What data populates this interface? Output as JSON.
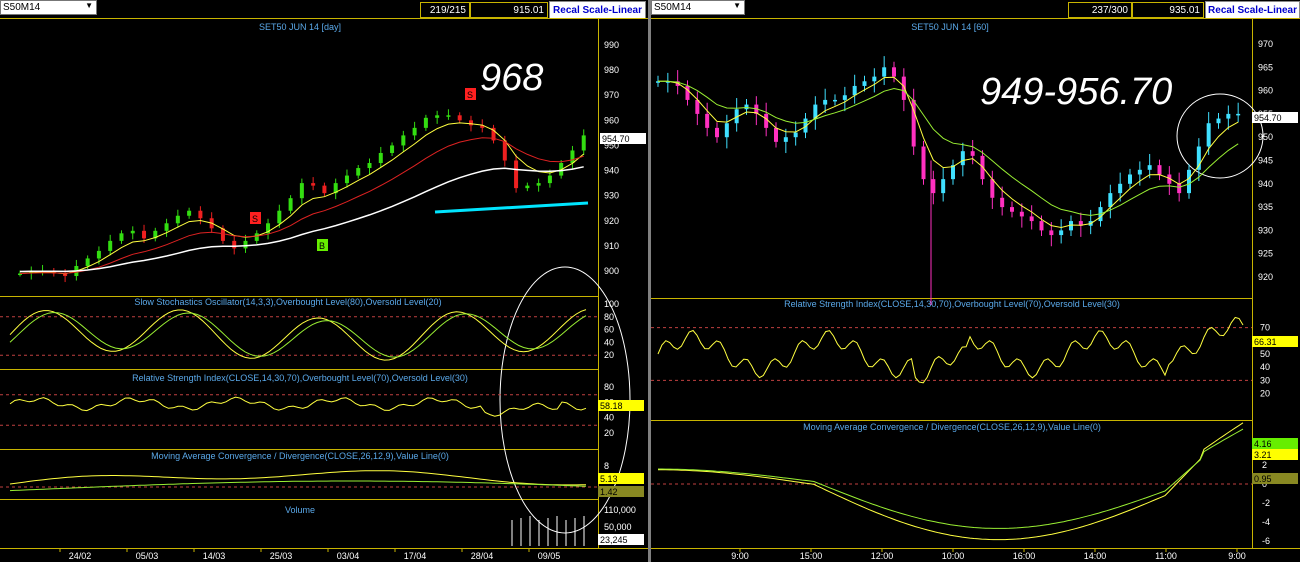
{
  "left": {
    "symbol": "S50M14",
    "bars": "219/215",
    "price": "915.01",
    "scale_button": "Recal Scale-Linear",
    "title": "SET50 JUN 14  [day]",
    "big_annotation": "968",
    "last_price": "954.70",
    "price_ticks": [
      "990",
      "980",
      "970",
      "960",
      "950",
      "940",
      "930",
      "920",
      "910",
      "900"
    ],
    "markers": [
      {
        "label": "S",
        "color": "#ff2020"
      },
      {
        "label": "S",
        "color": "#ff2020"
      },
      {
        "label": "B",
        "color": "#66ee00"
      }
    ],
    "stoch": {
      "title": "Slow Stochastics Oscillator(14,3,3),Overbought Level(80),Oversold Level(20)",
      "ticks": [
        "100",
        "80",
        "60",
        "40",
        "20"
      ]
    },
    "rsi": {
      "title": "Relative Strength Index(CLOSE,14,30,70),Overbought Level(70),Oversold Level(30)",
      "ticks": [
        "80",
        "60",
        "40",
        "20"
      ],
      "value": "58.18"
    },
    "macd": {
      "title": "Moving Average Convergence / Divergence(CLOSE,26,12,9),Value Line(0)",
      "ticks": [
        "8"
      ],
      "value1": "5.13",
      "value2": "1.42"
    },
    "volume": {
      "title": "Volume",
      "ticks": [
        "110,000",
        "50,000"
      ],
      "value": "23,245"
    },
    "dates": [
      "24/02",
      "05/03",
      "14/03",
      "25/03",
      "03/04",
      "17/04",
      "28/04",
      "09/05"
    ]
  },
  "right": {
    "symbol": "S50M14",
    "bars": "237/300",
    "price": "935.01",
    "scale_button": "Recal Scale-Linear",
    "title": "SET50 JUN 14  [60]",
    "big_annotation": "949-956.70",
    "last_price": "954.70",
    "price_ticks": [
      "970",
      "965",
      "960",
      "955",
      "950",
      "945",
      "940",
      "935",
      "930",
      "925",
      "920"
    ],
    "rsi": {
      "title": "Relative Strength Index(CLOSE,14,30,70),Overbought Level(70),Oversold Level(30)",
      "ticks": [
        "70",
        "60",
        "50",
        "40",
        "30",
        "20"
      ],
      "value": "66.31"
    },
    "macd": {
      "title": "Moving Average Convergence / Divergence(CLOSE,26,12,9),Value Line(0)",
      "ticks": [
        "4",
        "2",
        "0",
        "-2",
        "-4",
        "-6"
      ],
      "value1": "4.16",
      "value2": "3.21",
      "value3": "0.95"
    },
    "times": [
      "9:00",
      "15:00",
      "12:00",
      "10:00",
      "16:00",
      "14:00",
      "11:00",
      "9:00"
    ]
  },
  "chart_data": [
    {
      "type": "candlestick",
      "title": "SET50 JUN 14  [day]",
      "x_ticks": [
        "24/02",
        "05/03",
        "14/03",
        "25/03",
        "03/04",
        "17/04",
        "28/04",
        "09/05"
      ],
      "ylim": [
        895,
        995
      ],
      "last_price": 954.7,
      "approx_close": [
        899,
        900,
        900,
        899,
        898,
        902,
        905,
        908,
        912,
        915,
        916,
        913,
        916,
        919,
        922,
        924,
        921,
        917,
        912,
        909,
        912,
        915,
        919,
        924,
        929,
        935,
        934,
        931,
        935,
        938,
        941,
        943,
        947,
        950,
        954,
        957,
        961,
        962,
        962,
        960,
        958,
        957,
        952,
        944,
        933,
        934,
        935,
        938,
        943,
        948,
        954
      ],
      "annotation": "968",
      "panels": {
        "stochastic": {
          "overbought": 80,
          "oversold": 20,
          "ylim": [
            0,
            100
          ]
        },
        "rsi": {
          "last": 58.18,
          "overbought": 70,
          "oversold": 30
        },
        "macd": {
          "last": [
            5.13,
            1.42
          ]
        },
        "volume": {
          "last": 23245
        }
      }
    },
    {
      "type": "candlestick",
      "title": "SET50 JUN 14  [60]",
      "x_ticks": [
        "9:00",
        "15:00",
        "12:00",
        "10:00",
        "16:00",
        "14:00",
        "11:00",
        "9:00"
      ],
      "ylim": [
        915,
        972
      ],
      "last_price": 954.7,
      "approx_close": [
        962,
        962,
        961,
        958,
        955,
        952,
        950,
        953,
        956,
        957,
        955,
        952,
        949,
        950,
        951,
        954,
        957,
        958,
        958,
        959,
        961,
        962,
        963,
        965,
        963,
        958,
        948,
        941,
        938,
        941,
        944,
        947,
        946,
        941,
        937,
        935,
        934,
        933,
        932,
        930,
        929,
        930,
        932,
        931,
        932,
        935,
        938,
        940,
        942,
        943,
        944,
        942,
        940,
        938,
        943,
        948,
        953,
        954,
        955,
        955
      ],
      "annotation": "949-956.70",
      "panels": {
        "rsi": {
          "last": 66.31,
          "overbought": 70,
          "oversold": 30
        },
        "macd": {
          "last": [
            4.16,
            3.21,
            0.95
          ]
        }
      }
    }
  ]
}
